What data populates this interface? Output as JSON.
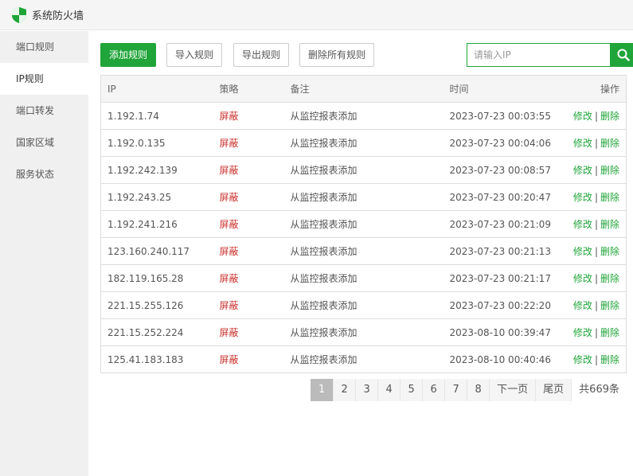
{
  "window": {
    "title": "系统防火墙",
    "logo_icon": "shield-icon"
  },
  "sidebar": {
    "items": [
      {
        "label": "端口规则",
        "active": false
      },
      {
        "label": "IP规则",
        "active": true
      },
      {
        "label": "端口转发",
        "active": false
      },
      {
        "label": "国家区域",
        "active": false
      },
      {
        "label": "服务状态",
        "active": false
      }
    ]
  },
  "toolbar": {
    "add_label": "添加规则",
    "import_label": "导入规则",
    "export_label": "导出规则",
    "delete_all_label": "删除所有规则"
  },
  "search": {
    "placeholder": "请输入IP",
    "value": "",
    "icon": "search-icon"
  },
  "table": {
    "headers": {
      "ip": "IP",
      "strategy": "策略",
      "note": "备注",
      "time": "时间",
      "ops": "操作"
    },
    "rows": [
      {
        "ip": "1.192.1.74",
        "strategy": "屏蔽",
        "note": "从监控报表添加",
        "time": "2023-07-23 00:03:55",
        "edit": "修改",
        "delete": "删除"
      },
      {
        "ip": "1.192.0.135",
        "strategy": "屏蔽",
        "note": "从监控报表添加",
        "time": "2023-07-23 00:04:06",
        "edit": "修改",
        "delete": "删除"
      },
      {
        "ip": "1.192.242.139",
        "strategy": "屏蔽",
        "note": "从监控报表添加",
        "time": "2023-07-23 00:08:57",
        "edit": "修改",
        "delete": "删除"
      },
      {
        "ip": "1.192.243.25",
        "strategy": "屏蔽",
        "note": "从监控报表添加",
        "time": "2023-07-23 00:20:47",
        "edit": "修改",
        "delete": "删除"
      },
      {
        "ip": "1.192.241.216",
        "strategy": "屏蔽",
        "note": "从监控报表添加",
        "time": "2023-07-23 00:21:09",
        "edit": "修改",
        "delete": "删除"
      },
      {
        "ip": "123.160.240.117",
        "strategy": "屏蔽",
        "note": "从监控报表添加",
        "time": "2023-07-23 00:21:13",
        "edit": "修改",
        "delete": "删除"
      },
      {
        "ip": "182.119.165.28",
        "strategy": "屏蔽",
        "note": "从监控报表添加",
        "time": "2023-07-23 00:21:17",
        "edit": "修改",
        "delete": "删除"
      },
      {
        "ip": "221.15.255.126",
        "strategy": "屏蔽",
        "note": "从监控报表添加",
        "time": "2023-07-23 00:22:20",
        "edit": "修改",
        "delete": "删除"
      },
      {
        "ip": "221.15.252.224",
        "strategy": "屏蔽",
        "note": "从监控报表添加",
        "time": "2023-08-10 00:39:47",
        "edit": "修改",
        "delete": "删除"
      },
      {
        "ip": "125.41.183.183",
        "strategy": "屏蔽",
        "note": "从监控报表添加",
        "time": "2023-08-10 00:40:46",
        "edit": "修改",
        "delete": "删除"
      }
    ]
  },
  "pagination": {
    "pages": [
      "1",
      "2",
      "3",
      "4",
      "5",
      "6",
      "7",
      "8"
    ],
    "current": "1",
    "next_label": "下一页",
    "last_label": "尾页",
    "total_label": "共669条"
  },
  "colors": {
    "accent": "#20a53a",
    "danger": "#c9302c",
    "sidebar_bg": "#f0f0f0"
  }
}
